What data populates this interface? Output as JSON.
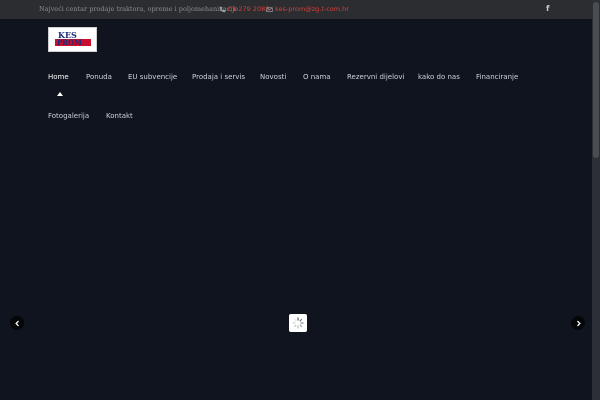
{
  "topbar": {
    "tagline": "Najveći centar prodaje traktora, opreme i poljomehanizacije",
    "phone": "01 279 2083",
    "email": "kes-prom@zg.t-com.hr",
    "social_icon": "facebook-icon",
    "accent_color": "#d7403b"
  },
  "logo": {
    "text": "KES PROM"
  },
  "nav": {
    "items": [
      {
        "label": "Home",
        "active": true
      },
      {
        "label": "Ponuda"
      },
      {
        "label": "EU subvencije"
      },
      {
        "label": "Prodaja i servis"
      },
      {
        "label": "Novosti"
      },
      {
        "label": "O nama"
      },
      {
        "label": "Rezervni dijelovi"
      },
      {
        "label": "kako do nas"
      },
      {
        "label": "Financiranje"
      },
      {
        "label": "Fotogalerija"
      },
      {
        "label": "Kontakt"
      }
    ]
  },
  "slider": {
    "prev_icon": "chevron-left-icon",
    "next_icon": "chevron-right-icon",
    "loading_icon": "spinner-icon"
  }
}
